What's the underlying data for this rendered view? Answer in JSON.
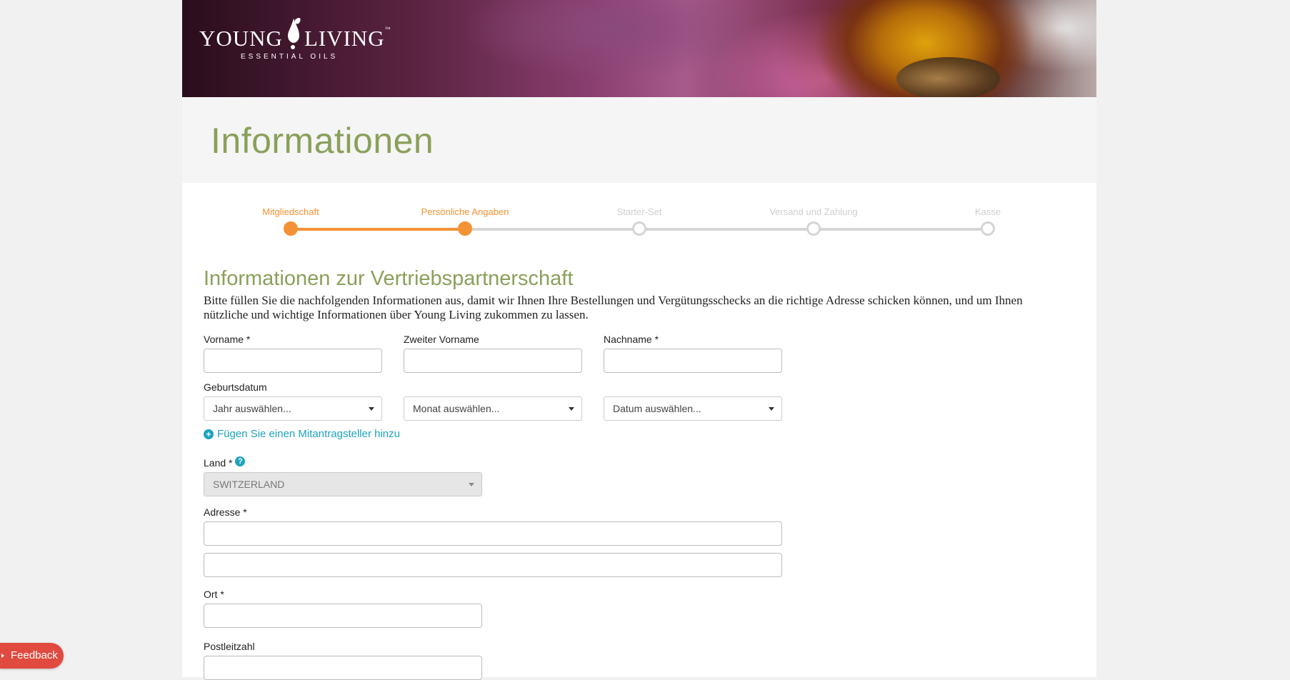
{
  "brand": {
    "name_part1": "YOUNG",
    "name_part2": "LIVING",
    "tagline": "ESSENTIAL OILS",
    "trademark": "™"
  },
  "page_title": "Informationen",
  "progress": {
    "steps": [
      {
        "label": "Mitgliedschaft",
        "state": "done"
      },
      {
        "label": "Persönliche Angaben",
        "state": "done"
      },
      {
        "label": "Starter-Set",
        "state": "pending"
      },
      {
        "label": "Versand und Zahlung",
        "state": "pending"
      },
      {
        "label": "Kasse",
        "state": "pending"
      }
    ],
    "completed_fraction": 0.25
  },
  "section": {
    "title": "Informationen zur Vertriebspartnerschaft",
    "intro": "Bitte füllen Sie die nachfolgenden Informationen aus, damit wir Ihnen Ihre Bestellungen und Vergütungsschecks an die richtige Adresse schicken können, und um Ihnen nützliche und wichtige Informationen über Young Living zukommen zu lassen."
  },
  "form": {
    "first_name": {
      "label": "Vorname *",
      "value": ""
    },
    "middle_name": {
      "label": "Zweiter Vorname",
      "value": ""
    },
    "last_name": {
      "label": "Nachname *",
      "value": ""
    },
    "birthdate": {
      "label": "Geburtsdatum",
      "year": "Jahr auswählen...",
      "month": "Monat auswählen...",
      "day": "Datum auswählen..."
    },
    "add_co_applicant": "Fügen Sie einen Mitantragsteller hinzu",
    "country": {
      "label": "Land *",
      "value": "SWITZERLAND",
      "help_icon": "?"
    },
    "address": {
      "label": "Adresse *",
      "line1": "",
      "line2": ""
    },
    "city": {
      "label": "Ort *",
      "value": ""
    },
    "postal_code": {
      "label": "Postleitzahl",
      "value": ""
    }
  },
  "feedback": {
    "label": "Feedback"
  },
  "colors": {
    "accent_orange": "#f39234",
    "title_green": "#8aa05a",
    "link_teal": "#1ea3bd",
    "feedback_red": "#e04a3f"
  }
}
